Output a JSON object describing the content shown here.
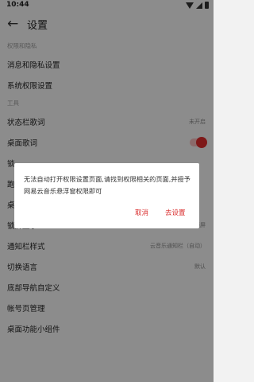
{
  "status_bar": {
    "time": "10:44"
  },
  "app_bar": {
    "title": "设置"
  },
  "sections": [
    {
      "header": "权限和隐私",
      "rows": [
        {
          "label": "消息和隐私设置"
        },
        {
          "label": "系统权限设置"
        }
      ]
    },
    {
      "header": "工具",
      "rows": [
        {
          "label": "状态栏歌词",
          "value": "未开启"
        },
        {
          "label": "桌面歌词",
          "toggle": true
        },
        {
          "label": "锁"
        },
        {
          "label": "跑"
        },
        {
          "label": "桌"
        },
        {
          "label": "锁屏显示",
          "value": "云音乐锁屏"
        },
        {
          "label": "通知栏样式",
          "value": "云音乐通知栏（自动）"
        },
        {
          "label": "切换语言",
          "value": "默认"
        },
        {
          "label": "底部导航自定义"
        },
        {
          "label": "帐号页管理"
        },
        {
          "label": "桌面功能小组件"
        }
      ]
    }
  ],
  "dialog": {
    "message": "无法自动打开权限设置页面,请找到权限相关的页面,并授予网易云音乐悬浮窗权限即可",
    "cancel_label": "取消",
    "confirm_label": "去设置"
  },
  "colors": {
    "accent": "#d92b2b",
    "background": "#f2f2f2"
  }
}
